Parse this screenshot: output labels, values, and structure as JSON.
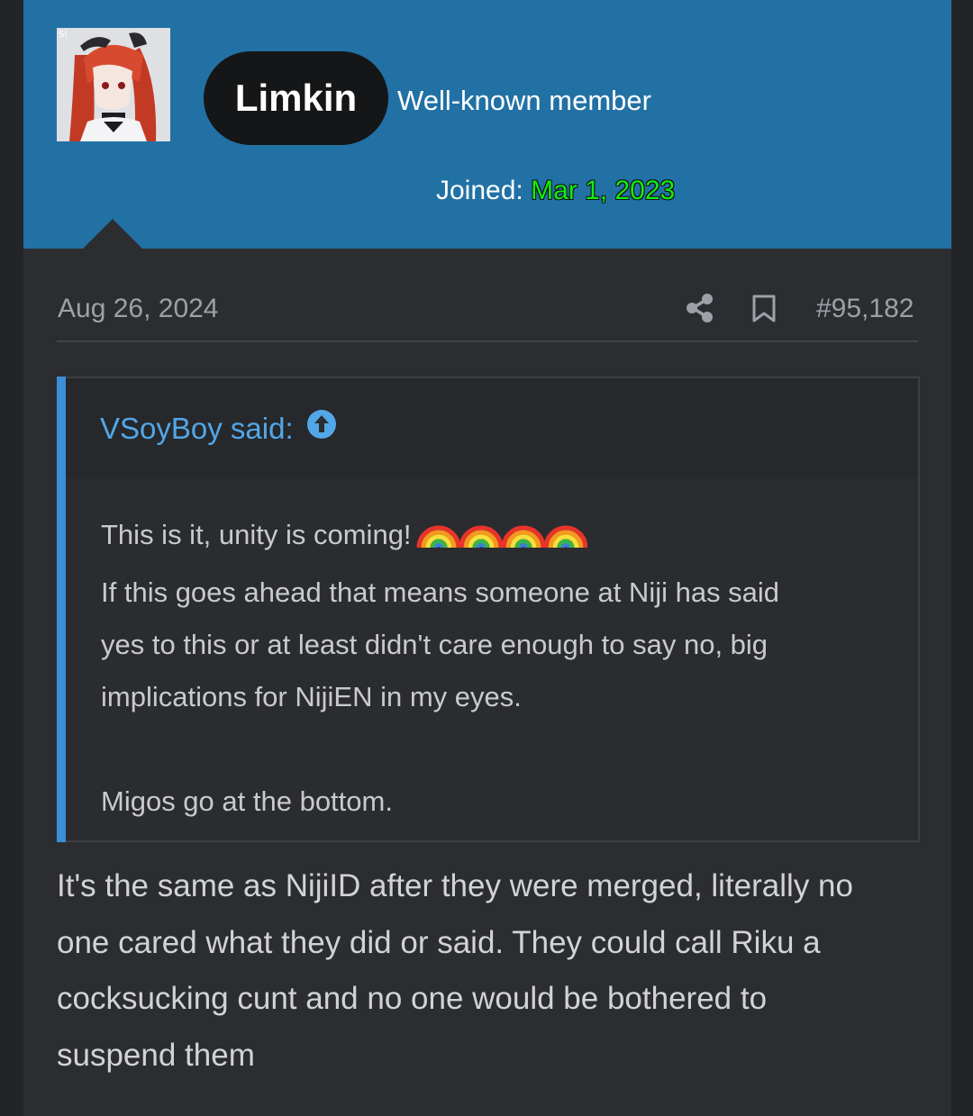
{
  "user": {
    "name": "Limkin",
    "title": "Well-known member",
    "joined_label": "Joined:",
    "joined_date": "Mar 1, 2023"
  },
  "post": {
    "date": "Aug 26, 2024",
    "number": "#95,182",
    "icons": {
      "share": "share-icon",
      "bookmark": "bookmark-icon"
    }
  },
  "quote": {
    "author": "VSoyBoy said:",
    "lines": [
      "This is it, unity is coming!",
      "If this goes ahead that means someone at Niji has said",
      "yes to this or at least didn't care enough to say no, big",
      "implications for NijiEN in my eyes.",
      "",
      "Migos go at the bottom."
    ],
    "emoji": "rainbow-emoji",
    "emoji_count": 4
  },
  "reply": {
    "lines": [
      "It's the same as NijiID after they were merged, literally no",
      "one cared what they did or said. They could call Riku a",
      "cocksucking cunt and no one would be bothered to",
      "suspend them"
    ]
  },
  "colors": {
    "header_bg": "#2271a5",
    "joined_date": "#12ee12",
    "quote_accent": "#3b8fd6",
    "quote_author": "#52a7e8"
  }
}
